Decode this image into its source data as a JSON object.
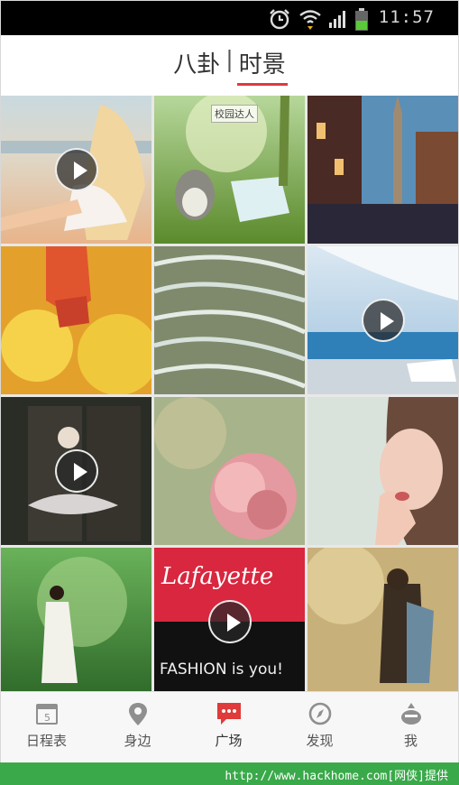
{
  "status_bar": {
    "time": "11:57",
    "icons": [
      "alarm-icon",
      "wifi-icon",
      "signal-icon",
      "battery-icon"
    ]
  },
  "header": {
    "tabs": [
      {
        "label": "八卦",
        "active": false
      },
      {
        "label": "时景",
        "active": true
      }
    ],
    "separator": "|",
    "accent_color": "#e03a3a"
  },
  "grid": {
    "tiles": [
      {
        "description": "girl on beach",
        "has_play": true,
        "tag": ""
      },
      {
        "description": "totoro in forest",
        "has_play": false,
        "tag": "校园达人"
      },
      {
        "description": "venice houses",
        "has_play": false,
        "tag": ""
      },
      {
        "description": "red boots in flowers",
        "has_play": false,
        "tag": ""
      },
      {
        "description": "rice terraces",
        "has_play": false,
        "tag": ""
      },
      {
        "description": "sea and curtain",
        "has_play": true,
        "tag": ""
      },
      {
        "description": "ballerina at door",
        "has_play": true,
        "tag": ""
      },
      {
        "description": "pink flower",
        "has_play": false,
        "tag": ""
      },
      {
        "description": "woman portrait",
        "has_play": false,
        "tag": ""
      },
      {
        "description": "girl in forest",
        "has_play": false,
        "tag": ""
      },
      {
        "description": "fashion poster",
        "has_play": true,
        "tag": ""
      },
      {
        "description": "couple hugging",
        "has_play": false,
        "tag": ""
      }
    ]
  },
  "bottom_nav": {
    "items": [
      {
        "label": "日程表",
        "icon": "calendar-icon",
        "active": false
      },
      {
        "label": "身边",
        "icon": "location-pin-icon",
        "active": false
      },
      {
        "label": "广场",
        "icon": "chat-bubble-icon",
        "active": true
      },
      {
        "label": "发现",
        "icon": "compass-icon",
        "active": false
      },
      {
        "label": "我",
        "icon": "profile-icon",
        "active": false
      }
    ],
    "active_color": "#e03a3a"
  },
  "watermark": {
    "text": "http://www.hackhome.com[网侠]提供"
  }
}
